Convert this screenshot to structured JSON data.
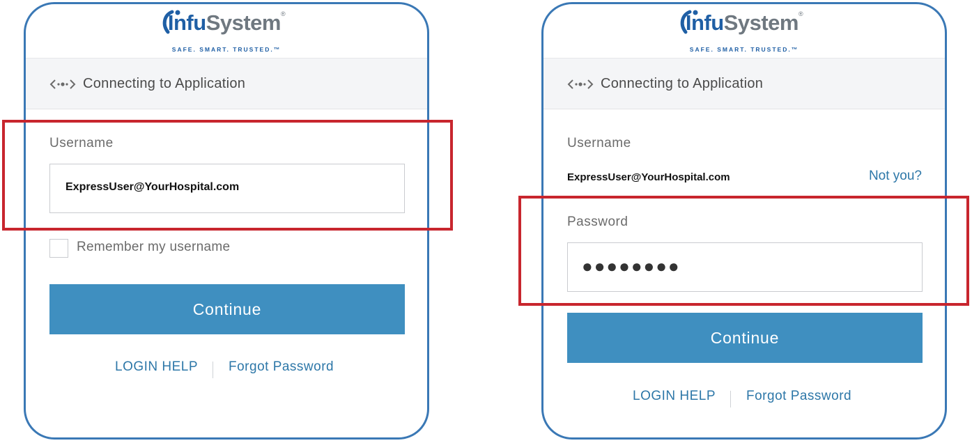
{
  "brand": {
    "name_part1": "Infu",
    "name_part2": "System",
    "trademark": "®",
    "tagline": "SAFE. SMART. TRUSTED.™",
    "primary_color": "#1f5fa5",
    "accent_color": "#3f8fc0",
    "highlight_color": "#c8262e"
  },
  "left_screen": {
    "banner_text": "Connecting to Application",
    "username_label": "Username",
    "username_value": "ExpressUser@YourHospital.com",
    "remember_label": "Remember my username",
    "remember_checked": false,
    "continue_label": "Continue",
    "login_help": "LOGIN HELP",
    "forgot_password": "Forgot Password"
  },
  "right_screen": {
    "banner_text": "Connecting to Application",
    "username_label": "Username",
    "username_value": "ExpressUser@YourHospital.com",
    "not_you": "Not you?",
    "password_label": "Password",
    "password_masked": "●●●●●●●●",
    "continue_label": "Continue",
    "login_help": "LOGIN HELP",
    "forgot_password": "Forgot Password"
  }
}
